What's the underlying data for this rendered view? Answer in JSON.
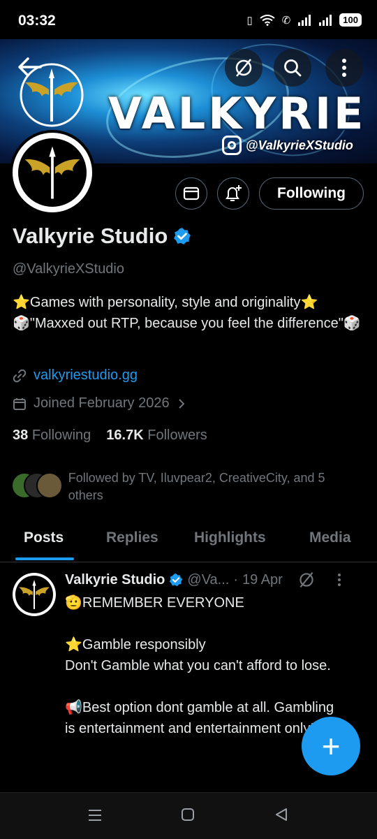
{
  "status_bar": {
    "time": "03:32",
    "battery": "100"
  },
  "banner": {
    "wordmark": "VALKYRIE",
    "instagram_handle": "@ValkyrieXStudio"
  },
  "profile": {
    "name": "Valkyrie Studio",
    "handle": "@ValkyrieXStudio",
    "bio": "⭐Games with personality, style and originality⭐ 🎲\"Maxxed out RTP, because you feel the difference\"🎲",
    "website": "valkyriestudio.gg",
    "joined": "Joined February 2026",
    "following_count": "38",
    "following_label": "Following",
    "followers_count": "16.7K",
    "followers_label": "Followers",
    "followed_by": "Followed by TV, Iluvpear2, CreativeCity, and 5 others",
    "follow_button": "Following"
  },
  "tabs": [
    {
      "label": "Posts",
      "active": true
    },
    {
      "label": "Replies",
      "active": false
    },
    {
      "label": "Highlights",
      "active": false
    },
    {
      "label": "Media",
      "active": false
    }
  ],
  "post": {
    "name": "Valkyrie Studio",
    "handle": "@Va...",
    "separator": "·",
    "date": "19 Apr",
    "body": "🫡REMEMBER EVERYONE\n\n⭐Gamble responsibly\nDon't Gamble what you can't afford to lose.\n\n📢Best option dont gamble at all. Gambling is entertainment and entertainment only!📢"
  },
  "fab": {
    "label": "+"
  },
  "colors": {
    "accent": "#1d9bf0",
    "secondary_text": "#71767b",
    "background": "#000000"
  }
}
